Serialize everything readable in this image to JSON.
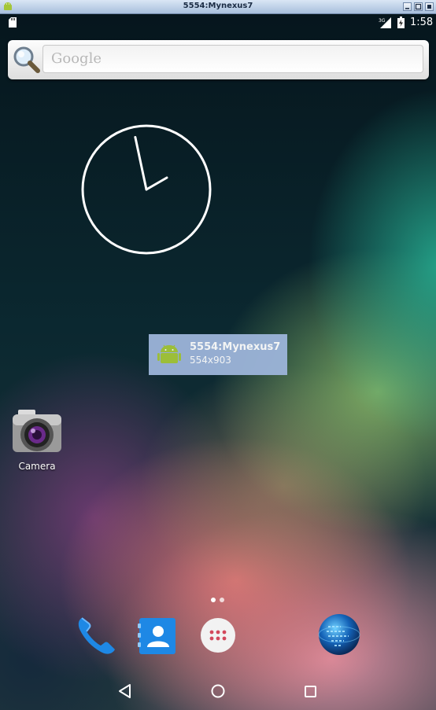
{
  "window": {
    "title": "5554:Mynexus7"
  },
  "status_bar": {
    "network_type": "3G",
    "time": "1:58"
  },
  "search": {
    "placeholder": "Google"
  },
  "overlay": {
    "title": "5554:Mynexus7",
    "subtitle": "554x903"
  },
  "desktop": {
    "camera_label": "Camera"
  },
  "clock_widget": {
    "hour_hand_angle_deg": 60,
    "minute_hand_angle_deg": -12
  },
  "icons": {
    "window_app": "android-icon",
    "status_left": "sd-card-icon",
    "signal": "signal-3g-icon",
    "battery": "battery-charging-icon",
    "search": "magnifier-icon",
    "dock": [
      "phone-icon",
      "contacts-icon",
      "app-drawer-icon",
      "browser-globe-icon"
    ],
    "nav": [
      "back-icon",
      "home-icon",
      "recents-icon"
    ]
  },
  "colors": {
    "overlay_bg": "#9db5da",
    "android_green": "#a4c639",
    "phone_blue": "#1e88e5"
  }
}
